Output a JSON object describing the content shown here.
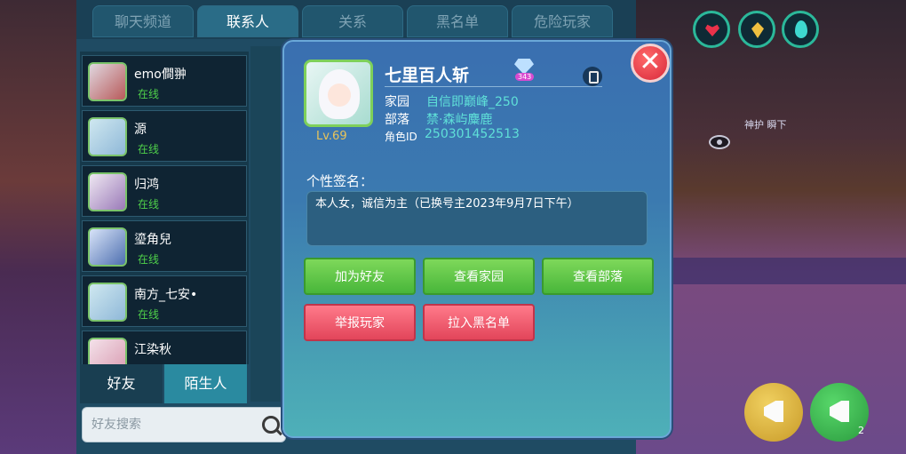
{
  "tabs": [
    "聊天频道",
    "联系人",
    "关系",
    "黑名单",
    "危险玩家"
  ],
  "contacts": [
    {
      "name": "emo僴翀",
      "status": "在线"
    },
    {
      "name": "源",
      "status": "在线"
    },
    {
      "name": "归鸿",
      "status": "在线"
    },
    {
      "name": "瑬角兒",
      "status": "在线"
    },
    {
      "name": "南方_七安•",
      "status": "在线"
    },
    {
      "name": "江染秋",
      "status": ""
    }
  ],
  "bottom_tabs": {
    "friends": "好友",
    "strangers": "陌生人"
  },
  "search": {
    "placeholder": "好友搜索"
  },
  "player": {
    "name": "七里百人斩",
    "badge_count": "343",
    "level": "Lv.69",
    "home_label": "家园",
    "home_value": "自信即巅峰_250",
    "tribe_label": "部落",
    "tribe_value": "禁·森屿麋鹿",
    "id_label": "角色ID",
    "id_value": "250301452513"
  },
  "signature": {
    "title": "个性签名：",
    "text": "本人女，诚信为主（已换号主2023年9月7日下午）"
  },
  "actions": {
    "add_friend": "加为好友",
    "view_home": "查看家园",
    "view_tribe": "查看部落",
    "report": "举报玩家",
    "blacklist": "拉入黑名单"
  },
  "world": {
    "npc_label": "神护 瞬下",
    "speaker_count": "2"
  },
  "colors": {
    "accent": "#2bb89a",
    "online": "#4fd14a",
    "value": "#5fe0d8",
    "danger": "#e2455a",
    "ok": "#48b63a"
  }
}
